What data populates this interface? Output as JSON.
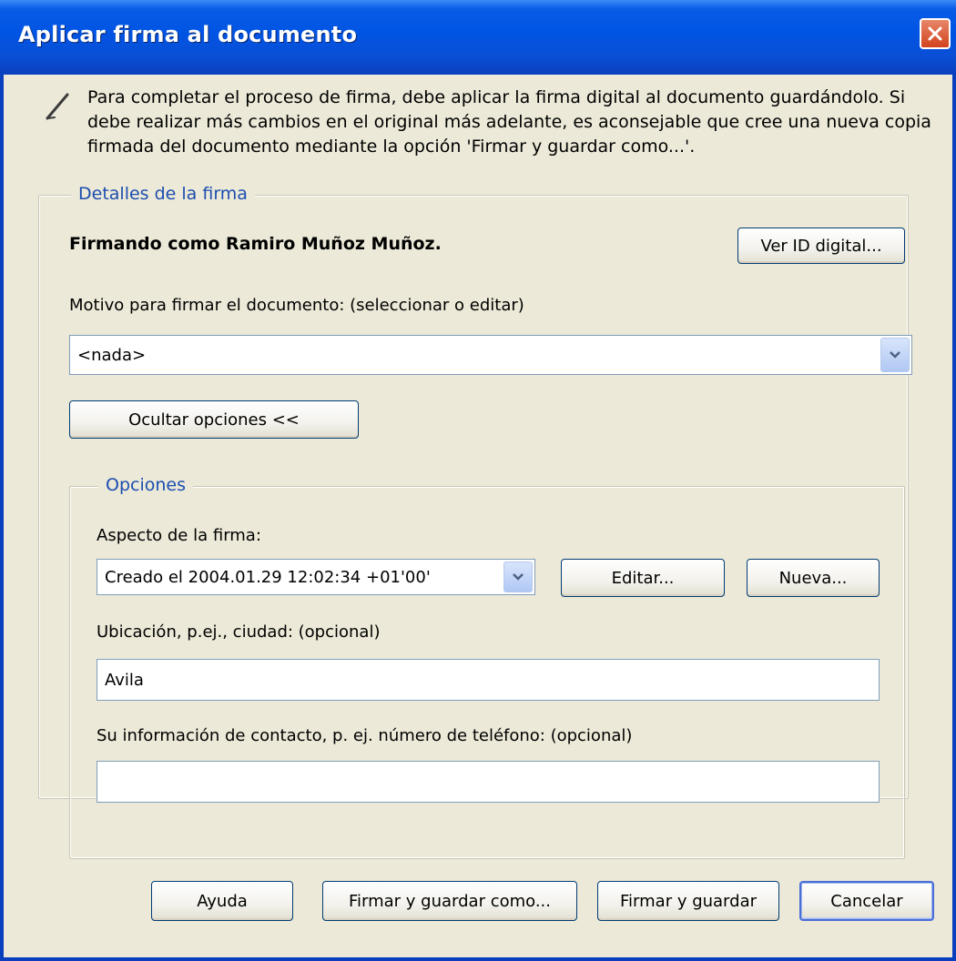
{
  "window": {
    "title": "Aplicar firma al documento"
  },
  "intro_text": "Para completar el proceso de firma, debe aplicar la firma digital al documento guardándolo. Si debe realizar más cambios en el original más adelante, es aconsejable que cree una nueva copia firmada del documento mediante la opción 'Firmar y guardar como...'.",
  "details": {
    "group_label": "Detalles de la firma",
    "signer_text": "Firmando como Ramiro Muñoz Muñoz.",
    "view_id_button": "Ver ID digital...",
    "reason_label": "Motivo para firmar el documento: (seleccionar o editar)",
    "reason_value": "<nada>",
    "hide_options_button": "Ocultar opciones <<"
  },
  "options": {
    "group_label": "Opciones",
    "appearance_label": "Aspecto de la firma:",
    "appearance_value": "Creado el 2004.01.29 12:02:34 +01'00'",
    "edit_button": "Editar...",
    "new_button": "Nueva...",
    "location_label": "Ubicación, p.ej., ciudad: (opcional)",
    "location_value": "Avila",
    "contact_label": "Su información de contacto, p. ej. número de teléfono: (opcional)",
    "contact_value": ""
  },
  "footer": {
    "help_button": "Ayuda",
    "sign_save_as_button": "Firmar y guardar como...",
    "sign_save_button": "Firmar y guardar",
    "cancel_button": "Cancelar"
  },
  "colors": {
    "titlebar": "#0054E3",
    "dialog_bg": "#ECE9D8",
    "group_label": "#1C4EB0",
    "close_button": "#D2431D"
  }
}
